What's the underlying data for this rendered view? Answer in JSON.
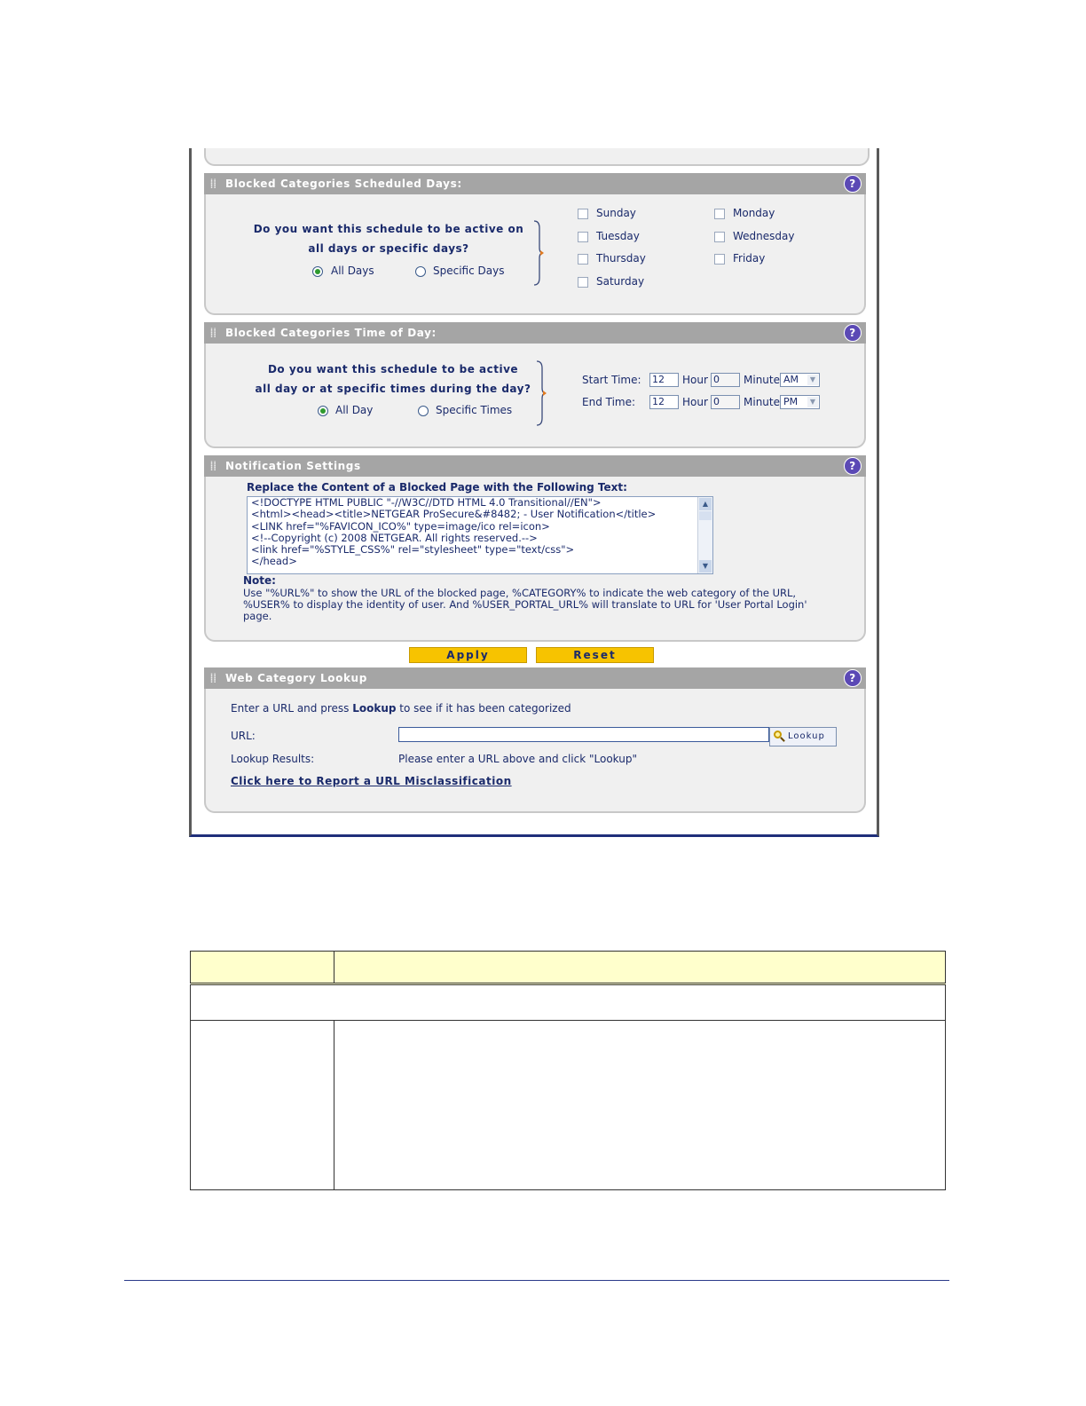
{
  "scheduled_days": {
    "title": "Blocked Categories Scheduled Days:",
    "question_line1": "Do you want this schedule to be active on",
    "question_line2": "all days or specific days?",
    "option_all": "All Days",
    "option_specific": "Specific Days",
    "selected": "All Days",
    "days": [
      {
        "label": "Sunday",
        "checked": false
      },
      {
        "label": "Monday",
        "checked": false
      },
      {
        "label": "Tuesday",
        "checked": false
      },
      {
        "label": "Wednesday",
        "checked": false
      },
      {
        "label": "Thursday",
        "checked": false
      },
      {
        "label": "Friday",
        "checked": false
      },
      {
        "label": "Saturday",
        "checked": false
      }
    ]
  },
  "time_of_day": {
    "title": "Blocked Categories Time of Day:",
    "question_line1": "Do you want this schedule to be active",
    "question_line2": "all day or at specific times during the day?",
    "option_all": "All Day",
    "option_specific": "Specific Times",
    "selected": "All Day",
    "start_label": "Start Time:",
    "end_label": "End Time:",
    "hour_label": "Hour",
    "minute_label": "Minute",
    "start": {
      "hour": "12",
      "minute": "0",
      "ampm": "AM"
    },
    "end": {
      "hour": "12",
      "minute": "0",
      "ampm": "PM"
    }
  },
  "notification": {
    "title": "Notification Settings",
    "heading": "Replace the Content of a Blocked Page with the Following Text:",
    "text_lines": [
      "<!DOCTYPE HTML PUBLIC \"-//W3C//DTD HTML 4.0 Transitional//EN\">",
      "<html><head><title>NETGEAR ProSecure&#8482; - User Notification</title>",
      "  <LINK href=\"%FAVICON_ICO%\" type=image/ico rel=icon>",
      "  <!--Copyright (c) 2008 NETGEAR. All rights reserved.-->",
      "  <link href=\"%STYLE_CSS%\" rel=\"stylesheet\" type=\"text/css\">",
      "</head>"
    ],
    "note_label": "Note:",
    "note_line1": "Use \"%URL%\" to show the URL of the blocked page, %CATEGORY% to indicate the web category of the URL,",
    "note_line2": "%USER% to display the identity of user. And %USER_PORTAL_URL% will translate to URL for 'User Portal Login'",
    "note_line3": "page."
  },
  "buttons": {
    "apply": "Apply",
    "reset": "Reset"
  },
  "lookup": {
    "title": "Web Category Lookup",
    "intro_before": "Enter a URL and press ",
    "intro_bold": "Lookup",
    "intro_after": " to see if it has been categorized",
    "url_label": "URL:",
    "url_value": "",
    "lookup_button": "Lookup",
    "results_label": "Lookup Results:",
    "results_value": "Please enter a URL above and click \"Lookup\"",
    "report_link": "Click here to Report a URL Misclassification"
  },
  "icons": {
    "help": "?"
  }
}
